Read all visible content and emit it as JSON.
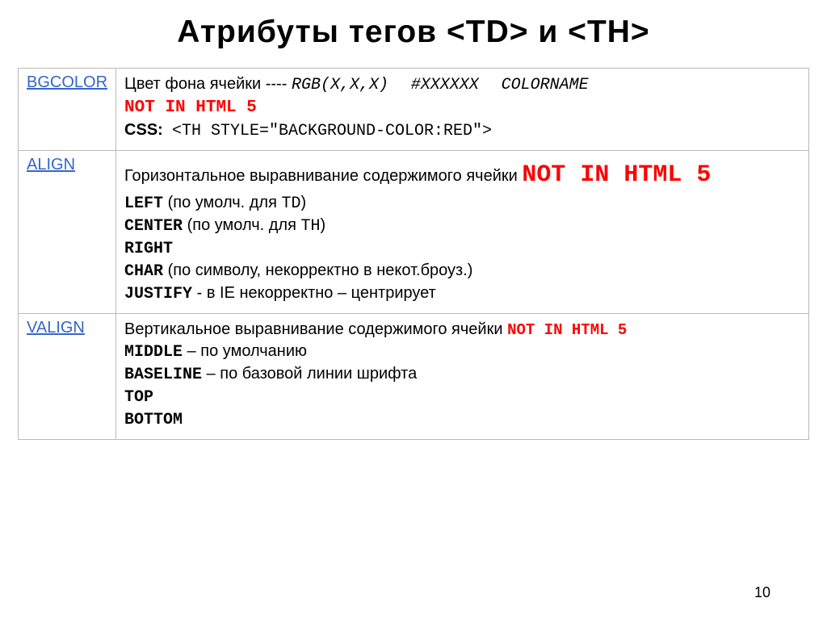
{
  "title": "Атрибуты тегов <TD> и <TH>",
  "rows": {
    "bgcolor": {
      "attr": "BGCOLOR",
      "desc": "Цвет фона ячейки ---- ",
      "rgb": "RGB(X,X,X)",
      "hex": "#XXXXXX",
      "colorname": "COLORNAME",
      "not5": "NOT IN HTML 5",
      "css_label": "CSS:",
      "css_code": "<TH STYLE=\"BACKGROUND-COLOR:RED\">"
    },
    "align": {
      "attr": "ALIGN",
      "desc": "Горизонтальное выравнивание содержимого ячейки ",
      "not5": "NOT IN HTML 5",
      "left": "LEFT",
      "left_note": " (по умолч. для ",
      "left_tag": "TD",
      "center": "CENTER",
      "center_note": " (по умолч. для ",
      "center_tag": "TH",
      "right": "RIGHT",
      "char": "CHAR",
      "char_note": " (по символу, некорректно в некот.броуз.)",
      "justify": "JUSTIFY",
      "justify_note": " - в IE некорректно – центрирует"
    },
    "valign": {
      "attr": "VALIGN",
      "desc": "Вертикальное выравнивание содержимого ячейки ",
      "not5": "NOT IN HTML 5",
      "middle": "MIDDLE",
      "middle_note": " – по умолчанию",
      "baseline": "BASELINE",
      "baseline_note": " – по базовой линии шрифта",
      "top": "TOP",
      "bottom": "BOTTOM"
    }
  },
  "page_number": "10"
}
